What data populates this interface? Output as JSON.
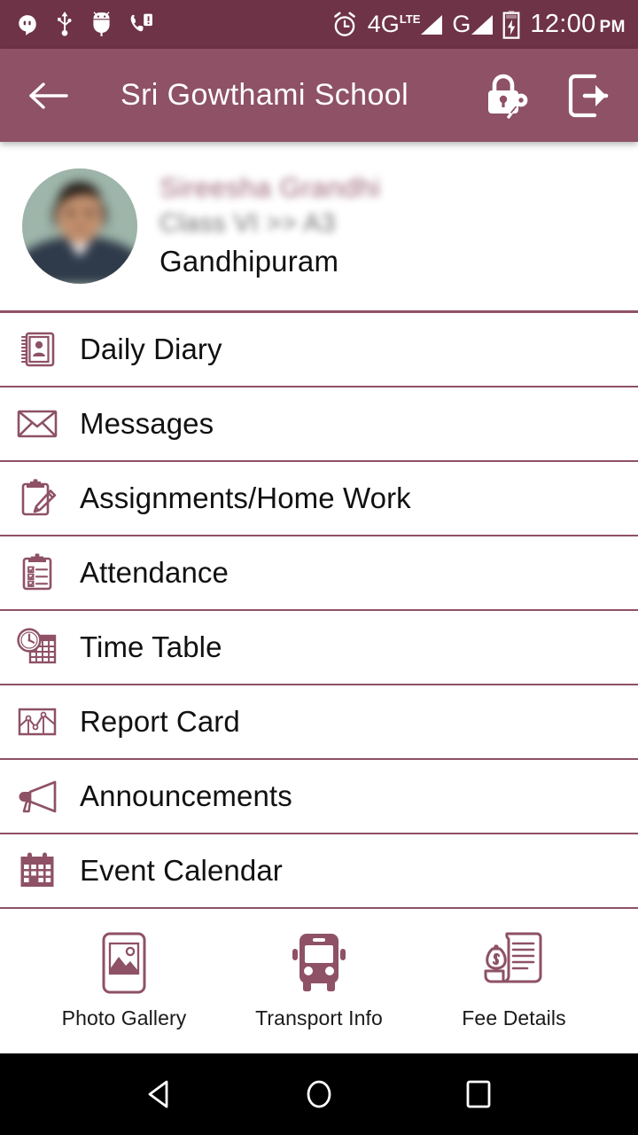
{
  "status_bar": {
    "time": "12:00",
    "am_pm": "PM",
    "network_primary": "4G",
    "network_primary_sup": "LTE",
    "network_secondary": "G",
    "left_icons": [
      "hangouts-icon",
      "usb-icon",
      "android-debug-icon",
      "missed-call-icon"
    ],
    "right_icons": [
      "alarm-icon",
      "signal-icon",
      "battery-charging-icon"
    ],
    "background_color": "#6e3347"
  },
  "app_bar": {
    "title": "Sri Gowthami School",
    "back_icon": "back-arrow-icon",
    "change_password_icon": "lock-key-icon",
    "logout_icon": "logout-icon",
    "background_color": "#8e5166"
  },
  "profile": {
    "avatar": "student-photo",
    "name": "Sireesha  Grandhi",
    "class": "Class VI >> A3",
    "place": "Gandhipuram",
    "name_color": "#8e5166",
    "class_color": "#5d5d5d",
    "place_color": "#101010"
  },
  "menu": {
    "accent_color": "#8e5166",
    "items": [
      {
        "label": "Daily Diary",
        "icon": "address-book-icon"
      },
      {
        "label": "Messages",
        "icon": "envelope-icon"
      },
      {
        "label": "Assignments/Home Work",
        "icon": "clipboard-pencil-icon"
      },
      {
        "label": "Attendance",
        "icon": "checklist-clipboard-icon"
      },
      {
        "label": "Time Table",
        "icon": "clock-calendar-icon"
      },
      {
        "label": "Report Card",
        "icon": "chart-icon"
      },
      {
        "label": "Announcements",
        "icon": "megaphone-icon"
      },
      {
        "label": "Event Calendar",
        "icon": "calendar-icon"
      }
    ]
  },
  "bottom_tabs": {
    "items": [
      {
        "label": "Photo Gallery",
        "icon": "photo-gallery-icon"
      },
      {
        "label": "Transport Info",
        "icon": "bus-icon"
      },
      {
        "label": "Fee Details",
        "icon": "invoice-money-icon"
      }
    ]
  },
  "nav_bar": {
    "back": "nav-back-icon",
    "home": "nav-home-icon",
    "recents": "nav-recents-icon"
  }
}
